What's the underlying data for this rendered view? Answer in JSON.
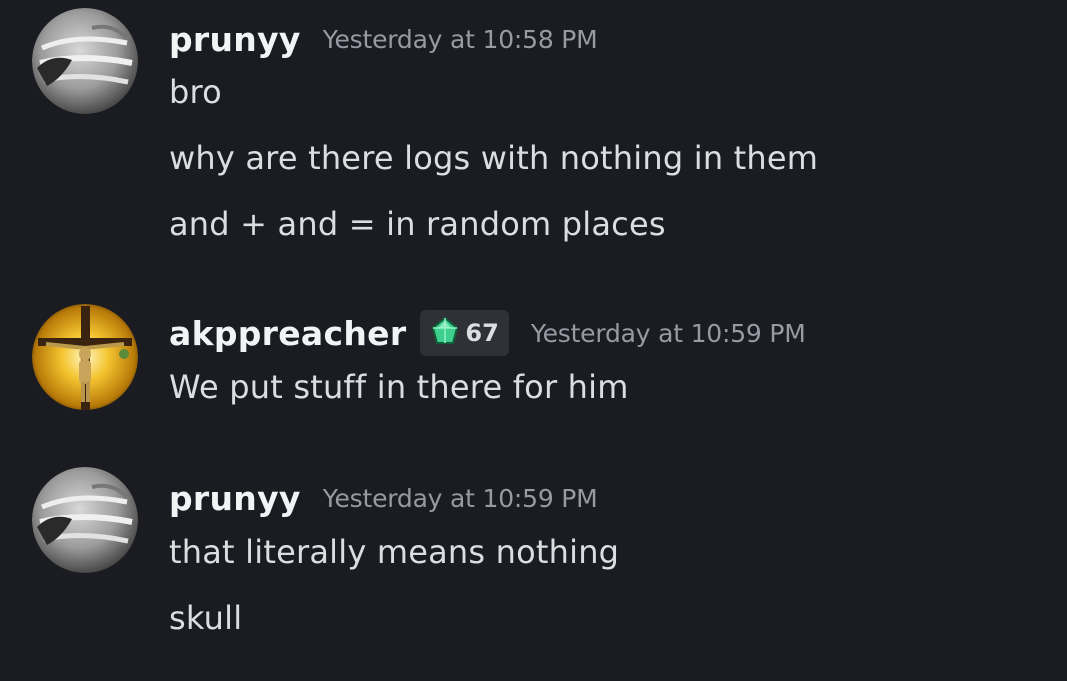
{
  "messages": [
    {
      "author": "prunyy",
      "timestamp": "Yesterday at 10:58 PM",
      "lines": [
        "bro",
        "why are there logs with nothing in them",
        "and + and = in random places"
      ]
    },
    {
      "author": "akppreacher",
      "badge": {
        "icon": "gem-icon",
        "count": "67",
        "color": "#3ecf8e"
      },
      "timestamp": "Yesterday at 10:59 PM",
      "lines": [
        "We put stuff in there for him"
      ]
    },
    {
      "author": "prunyy",
      "timestamp": "Yesterday at 10:59 PM",
      "lines": [
        "that literally means nothing",
        "skull"
      ]
    }
  ]
}
